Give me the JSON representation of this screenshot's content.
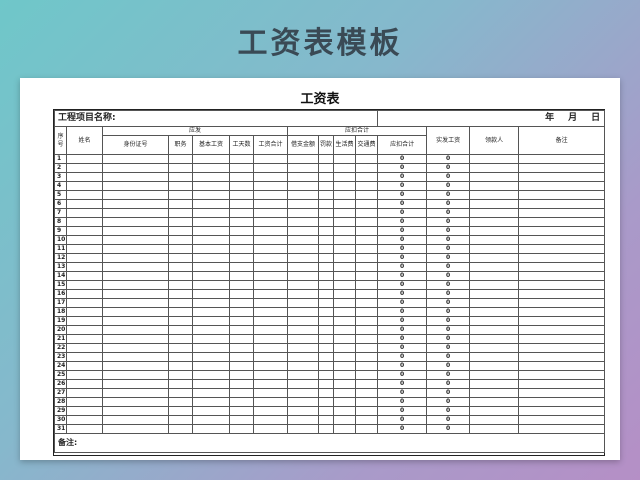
{
  "banner_title": "工资表模板",
  "sheet": {
    "title": "工资表",
    "project_label": "工程项目名称:",
    "date_parts": [
      "年",
      "月",
      "日"
    ],
    "headers": {
      "seq": "序号",
      "name": "姓名",
      "payable": "应发",
      "id_card": "身份证号",
      "position": "职务",
      "base_salary": "基本工资",
      "work_days": "工天数",
      "salary_total": "工资合计",
      "deductions": "应扣合计",
      "advance": "借支金额",
      "fine": "罚款",
      "living_fee": "生活费",
      "transport_fee": "交通费",
      "deduct_total": "应扣合计",
      "actual_pay": "实发工资",
      "receiver": "领款人",
      "remarks": "备注"
    },
    "rows": [
      "1",
      "2",
      "3",
      "4",
      "5",
      "6",
      "7",
      "8",
      "9",
      "10",
      "11",
      "12",
      "13",
      "14",
      "15",
      "16",
      "17",
      "18",
      "19",
      "20",
      "21",
      "22",
      "23",
      "24",
      "25",
      "26",
      "27",
      "28",
      "29",
      "30",
      "31"
    ],
    "zero_value": "0",
    "note_label": "备注:"
  }
}
